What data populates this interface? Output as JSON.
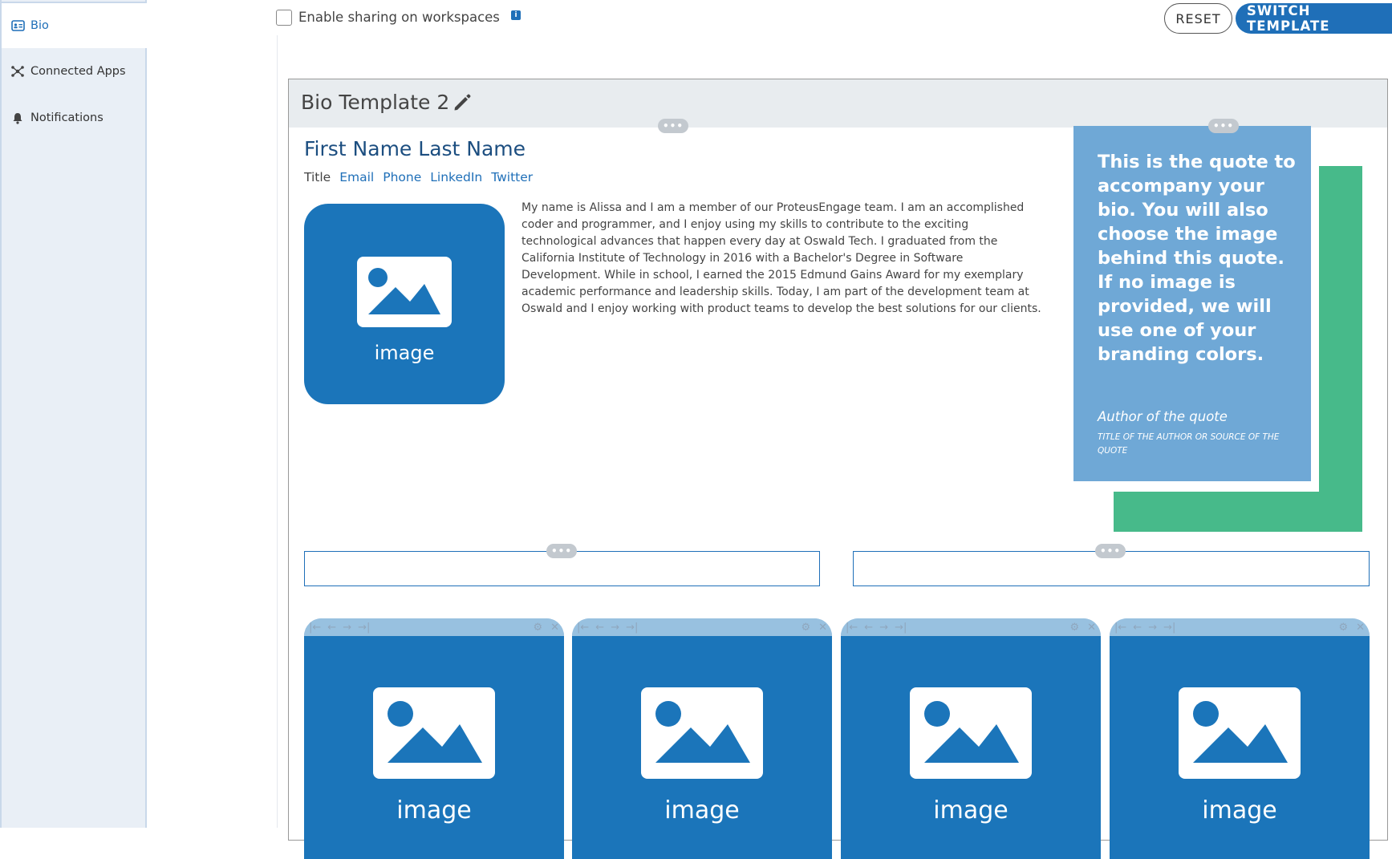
{
  "sidebar": {
    "items": [
      {
        "label": "Bio",
        "icon": "id-card-icon"
      },
      {
        "label": "Connected Apps",
        "icon": "connected-apps-icon"
      },
      {
        "label": "Notifications",
        "icon": "bell-icon"
      }
    ]
  },
  "topbar": {
    "share_label": "Enable sharing on workspaces",
    "info_glyph": "i",
    "reset_label": "RESET",
    "switch_label": "SWITCH TEMPLATE"
  },
  "panel": {
    "title": "Bio Template 2",
    "dots": "•••"
  },
  "profile": {
    "name": "First Name Last Name",
    "title": "Title",
    "links": [
      "Email",
      "Phone",
      "LinkedIn",
      "Twitter"
    ],
    "image_label": "image",
    "bio": "My name is Alissa and I am a member of our ProteusEngage team. I am an accomplished coder and programmer, and I enjoy using my skills to contribute to the exciting technological advances that happen every day at Oswald Tech. I graduated from the California Institute of Technology in 2016 with a Bachelor's Degree in Software Development. While in school, I earned the 2015 Edmund Gains Award for my exemplary academic performance and leadership skills. Today, I am part of the development team at Oswald and I enjoy working with product teams to develop the best solutions for our clients."
  },
  "quote": {
    "text": "This is the quote to accompany your bio. You will also choose the image behind this quote. If no image is provided, we will use one of your branding colors.",
    "author": "Author of the quote",
    "source": "TITLE OF THE AUTHOR OR SOURCE OF THE QUOTE"
  },
  "tiles": {
    "image_label": "image",
    "toolbar_left": [
      "|←",
      "←",
      "→",
      "→|"
    ],
    "toolbar_right": [
      "⚙",
      "✕"
    ]
  },
  "colors": {
    "accent": "#1f6fb8",
    "image_blue": "#1b75ba",
    "quote_blue": "#6fa8d6",
    "green": "#47ba8a"
  }
}
